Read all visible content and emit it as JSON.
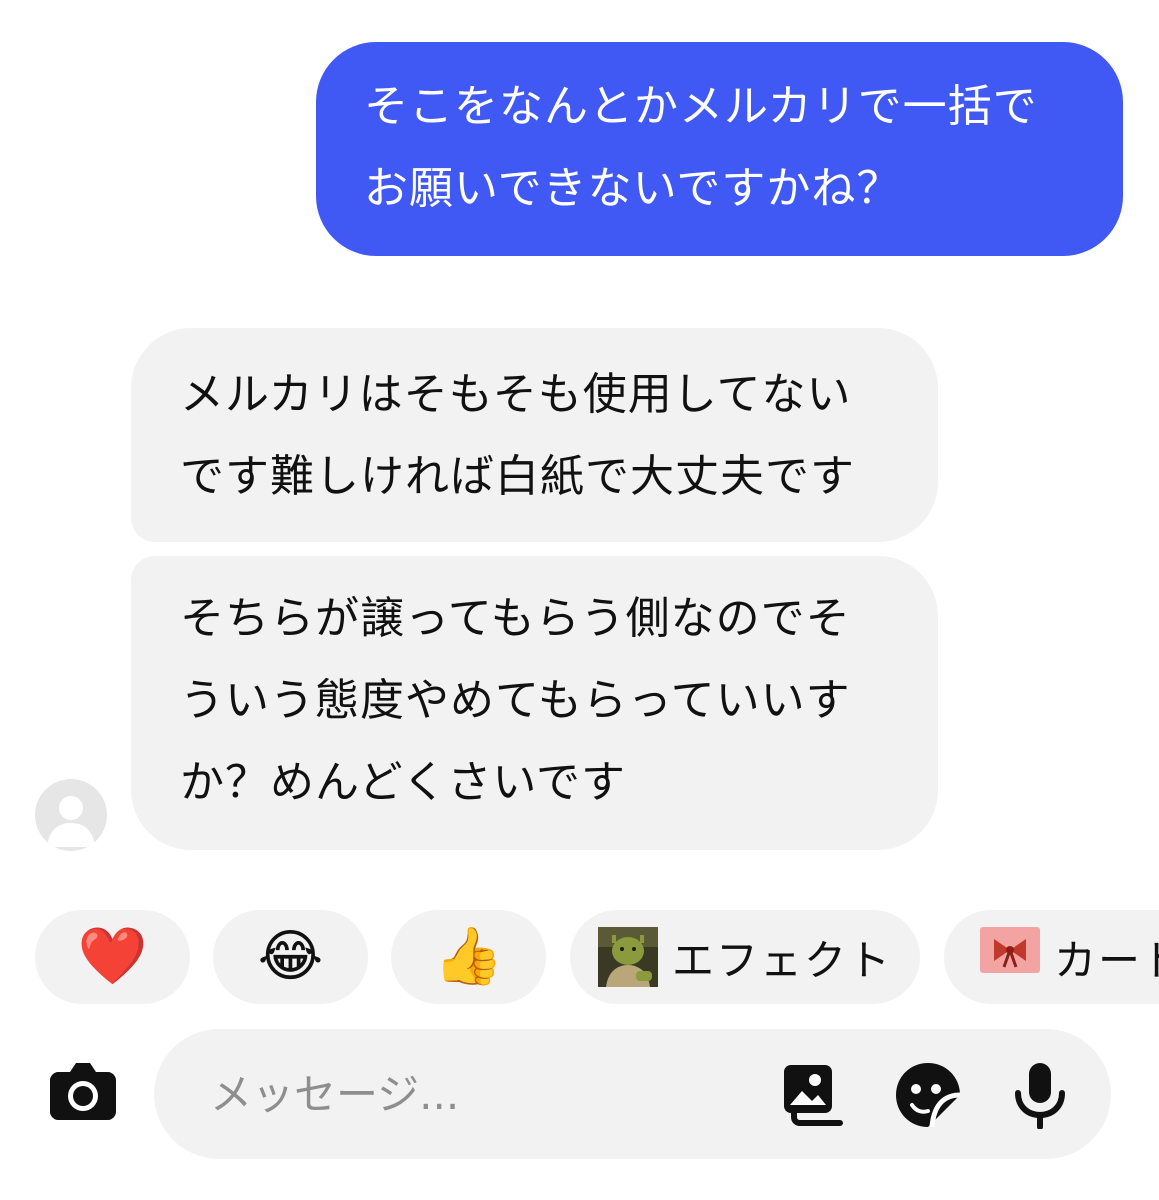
{
  "messages": [
    {
      "sender": "me",
      "text": "そこをなんとかメルカリで一括で\nお願いできないですかね？"
    },
    {
      "sender": "other",
      "text": "メルカリはそもそも使用してない\nです難しければ白紙で大丈夫です"
    },
    {
      "sender": "other",
      "text": "そちらが譲ってもらう側なのでそ\nういう態度やめてもらっていいす\nか？めんどくさいです"
    }
  ],
  "reactions": [
    {
      "emoji": "❤️",
      "icon": "heart-icon"
    },
    {
      "emoji": "😂",
      "icon": "tears-of-joy-icon"
    },
    {
      "emoji": "👍",
      "icon": "thumbs-up-icon"
    }
  ],
  "actions": {
    "effect_label": "エフェクト",
    "card_label": "カード"
  },
  "composer": {
    "placeholder": "メッセージ..."
  },
  "colors": {
    "outgoing_bubble": "#4059f5",
    "incoming_bubble": "#f2f2f2",
    "background": "#ffffff"
  },
  "icons": [
    "avatar-placeholder-icon",
    "camera-icon",
    "gallery-icon",
    "sticker-icon",
    "microphone-icon"
  ]
}
